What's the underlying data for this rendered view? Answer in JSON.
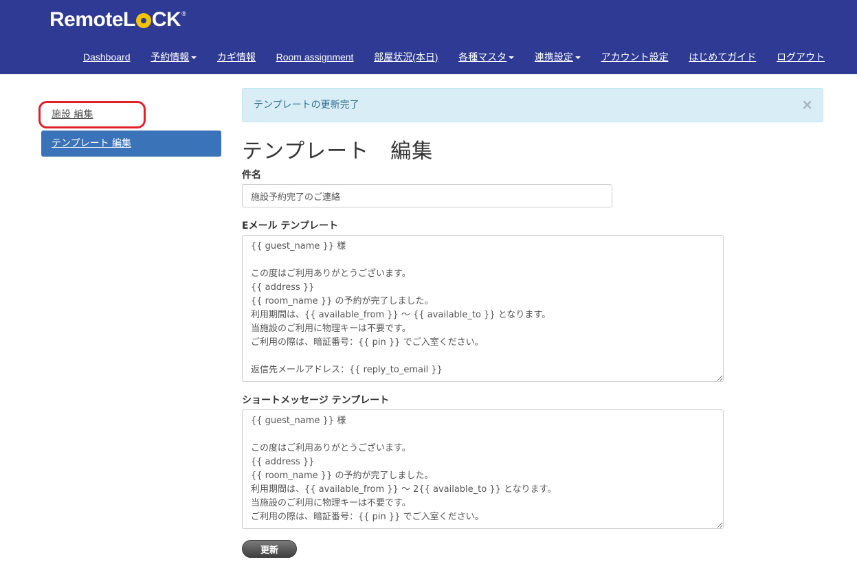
{
  "logo": {
    "part1": "Remote",
    "part2_l": "L",
    "part2_rest": "CK",
    "tm": "®"
  },
  "nav": [
    {
      "label": "Dashboard",
      "dropdown": false
    },
    {
      "label": "予約情報",
      "dropdown": true
    },
    {
      "label": "カギ情報",
      "dropdown": false
    },
    {
      "label": "Room assignment",
      "dropdown": false
    },
    {
      "label": "部屋状況(本日)",
      "dropdown": false
    },
    {
      "label": "各種マスタ",
      "dropdown": true
    },
    {
      "label": "連携設定",
      "dropdown": true
    },
    {
      "label": "アカウント設定",
      "dropdown": false
    },
    {
      "label": "はじめてガイド",
      "dropdown": false
    },
    {
      "label": "ログアウト",
      "dropdown": false
    }
  ],
  "sidebar": {
    "items": [
      {
        "label": "施設 編集",
        "active": false
      },
      {
        "label": "テンプレート 編集",
        "active": true
      }
    ]
  },
  "alert": {
    "message": "テンプレートの更新完了",
    "close": "×"
  },
  "page": {
    "title": "テンプレート　編集"
  },
  "form": {
    "subject_label": "件名",
    "subject_value": "施設予約完了のご連絡",
    "email_label": "Eメール テンプレート",
    "email_value": "{{ guest_name }} 様\n\nこの度はご利用ありがとうございます。\n{{ address }}\n{{ room_name }} の予約が完了しました。\n利用期間は、{{ available_from }} ～ {{ available_to }} となります。\n当施設のご利用に物理キーは不要です。\nご利用の際は、暗証番号：{{ pin }} でご入室ください。\n\n返信先メールアドレス：{{ reply_to_email }}",
    "sms_label": "ショートメッセージ テンプレート",
    "sms_value": "{{ guest_name }} 様\n\nこの度はご利用ありがとうございます。\n{{ address }}\n{{ room_name }} の予約が完了しました。\n利用期間は、{{ available_from }} ～ 2{{ available_to }} となります。\n当施設のご利用に物理キーは不要です。\nご利用の際は、暗証番号：{{ pin }} でご入室ください。",
    "submit_label": "更新"
  },
  "colors": {
    "header_bg": "#2e3a93",
    "logo_accent": "#f5c400",
    "sidebar_active": "#3a73b7",
    "alert_bg": "#d9edf7",
    "annotation_red": "#e0202a"
  }
}
